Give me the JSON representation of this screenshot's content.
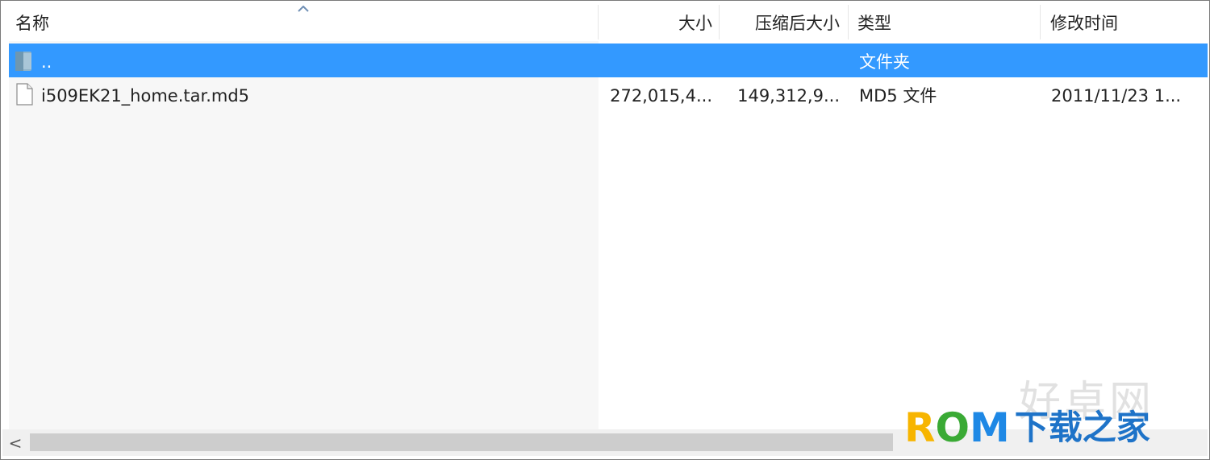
{
  "columns": {
    "name": "名称",
    "size": "大小",
    "packed": "压缩后大小",
    "type": "类型",
    "modified": "修改时间"
  },
  "rows": [
    {
      "name": "..",
      "size": "",
      "packed": "",
      "type": "文件夹",
      "modified": "",
      "icon": "folder-icon",
      "selected": true
    },
    {
      "name": "i509EK21_home.tar.md5",
      "size": "272,015,4...",
      "packed": "149,312,9...",
      "type": "MD5 文件",
      "modified": "2011/11/23 1...",
      "icon": "file-icon",
      "selected": false
    }
  ],
  "scrollbar": {
    "left_arrow": "<"
  },
  "watermark": {
    "top": "好卓网",
    "brand_r": "R",
    "brand_o": "O",
    "brand_m": "M",
    "brand_cn": "下载之家"
  },
  "colors": {
    "selection": "#3399ff",
    "name_column_bg": "#f7f7f7"
  }
}
